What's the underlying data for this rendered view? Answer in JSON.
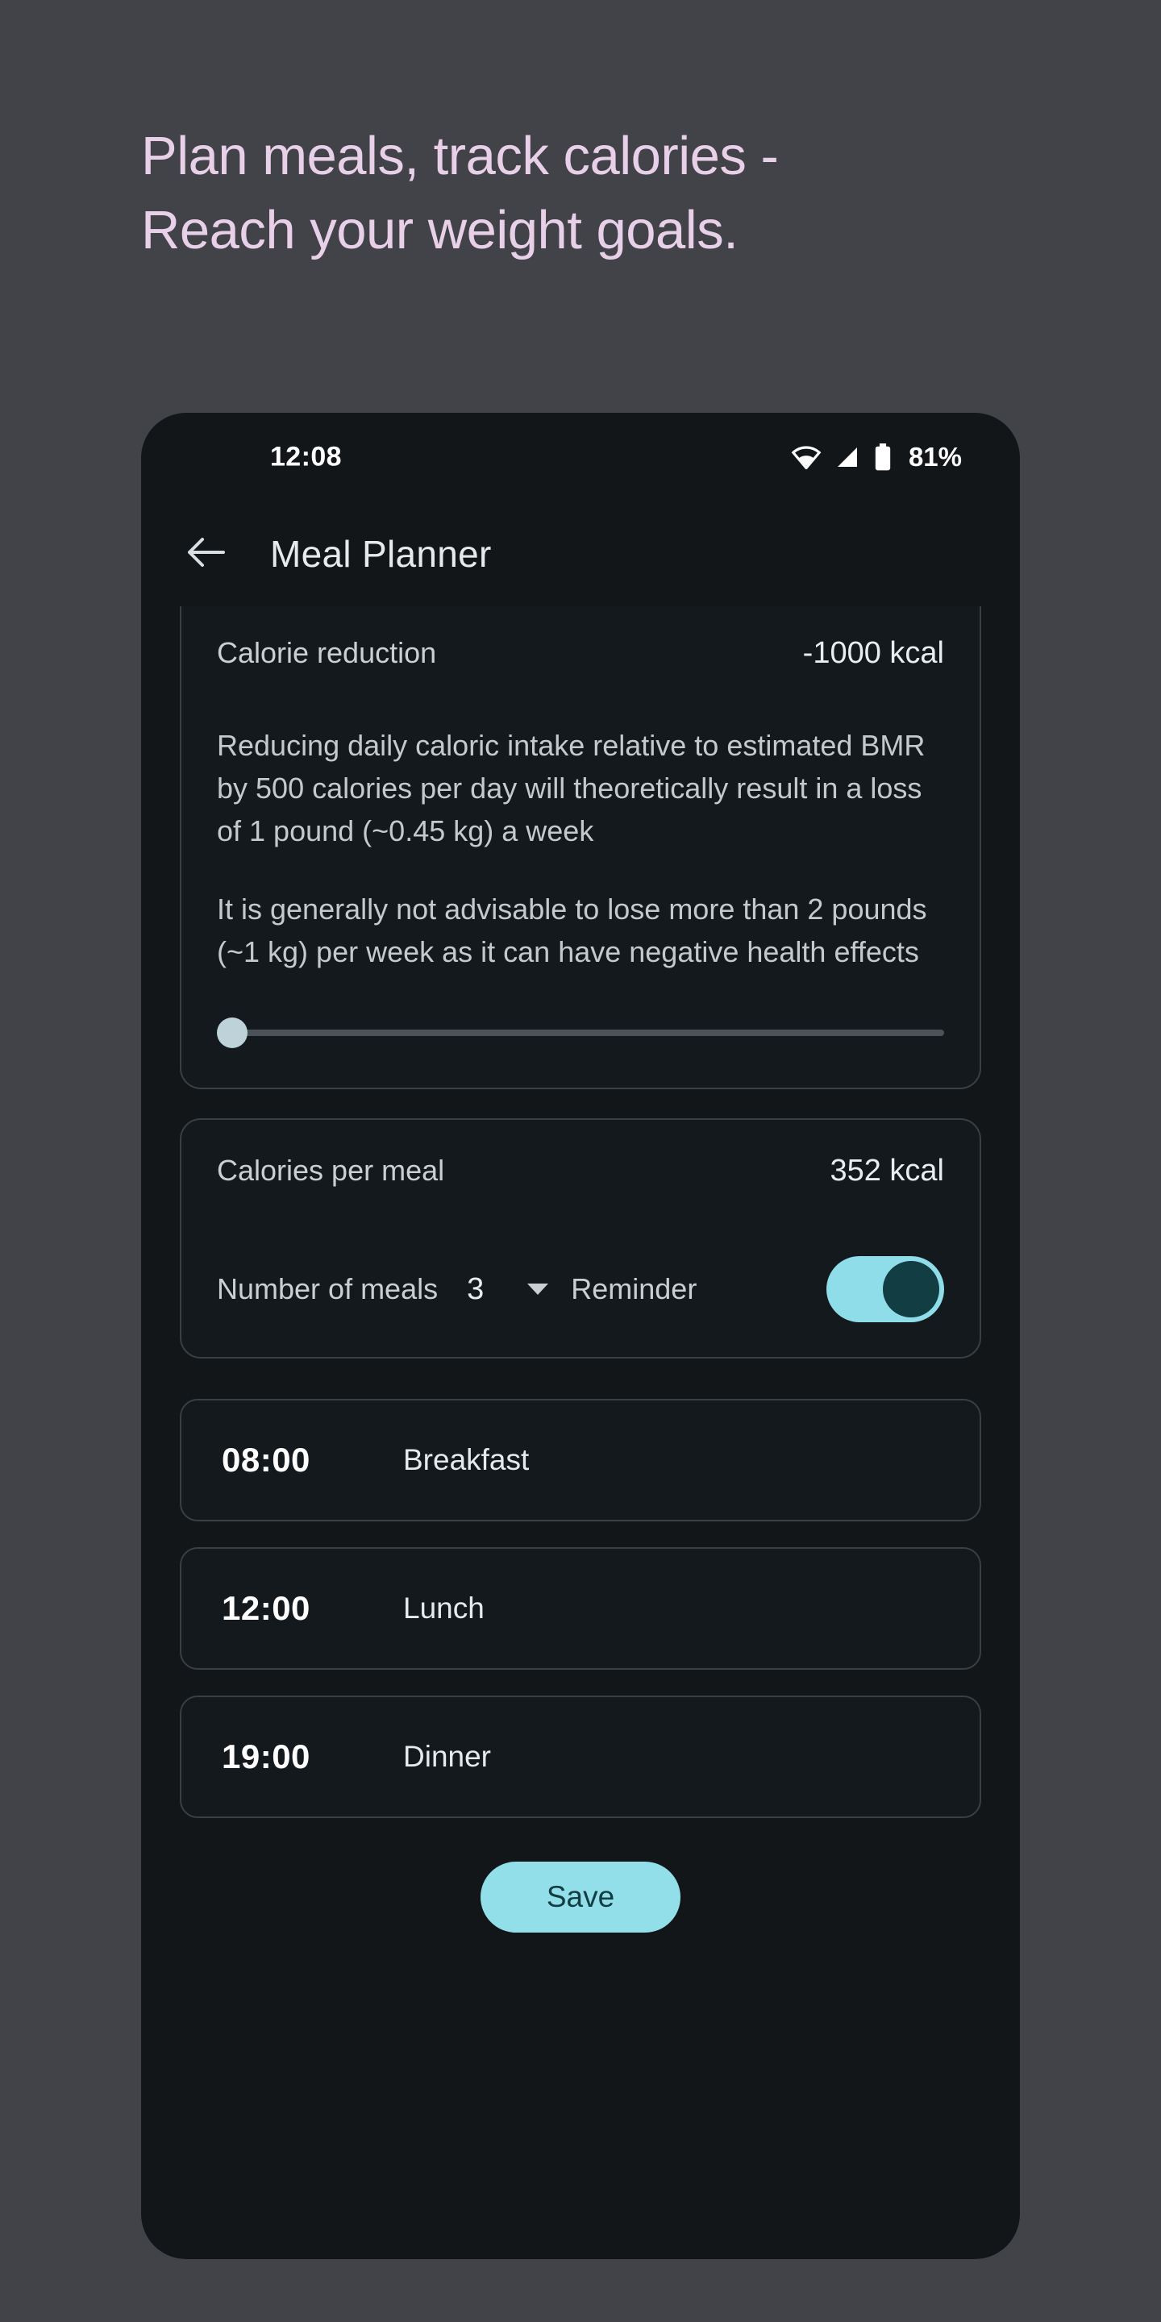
{
  "promo": {
    "line1": "Plan meals, track calories -",
    "line2": "Reach your weight goals.",
    "text_color": "#e8d0e8"
  },
  "statusbar": {
    "time": "12:08",
    "battery_percent": "81%",
    "icons": [
      "wifi-icon",
      "cellular-signal-icon",
      "battery-icon"
    ]
  },
  "appbar": {
    "back_icon": "back-arrow-icon",
    "title": "Meal Planner"
  },
  "calorie_reduction_card": {
    "label": "Calorie reduction",
    "value": "-1000 kcal",
    "paragraph1": "Reducing daily caloric intake relative to estimated BMR by 500 calories per day will theoretically result in a loss of 1 pound (~0.45 kg) a week",
    "paragraph2": "It is generally not advisable to lose more than 2 pounds (~1 kg) per week as it can have negative health effects",
    "slider": {
      "name": "calorie-reduction-slider",
      "position_percent": 0,
      "thumb_color": "#bdd3d9",
      "track_color": "#4c5358"
    }
  },
  "calories_per_meal_card": {
    "label": "Calories per meal",
    "value": "352 kcal",
    "meals_label": "Number of meals",
    "meals_count": "3",
    "dropdown_icon": "chevron-down-icon",
    "reminder_label": "Reminder",
    "reminder_enabled": true,
    "toggle_on_color": "#8fdde8",
    "toggle_knob_color": "#123d43"
  },
  "meals": [
    {
      "time": "08:00",
      "name": "Breakfast"
    },
    {
      "time": "12:00",
      "name": "Lunch"
    },
    {
      "time": "19:00",
      "name": "Dinner"
    }
  ],
  "save_button": {
    "label": "Save",
    "background": "#93dfe9",
    "text_color": "#123d43"
  }
}
